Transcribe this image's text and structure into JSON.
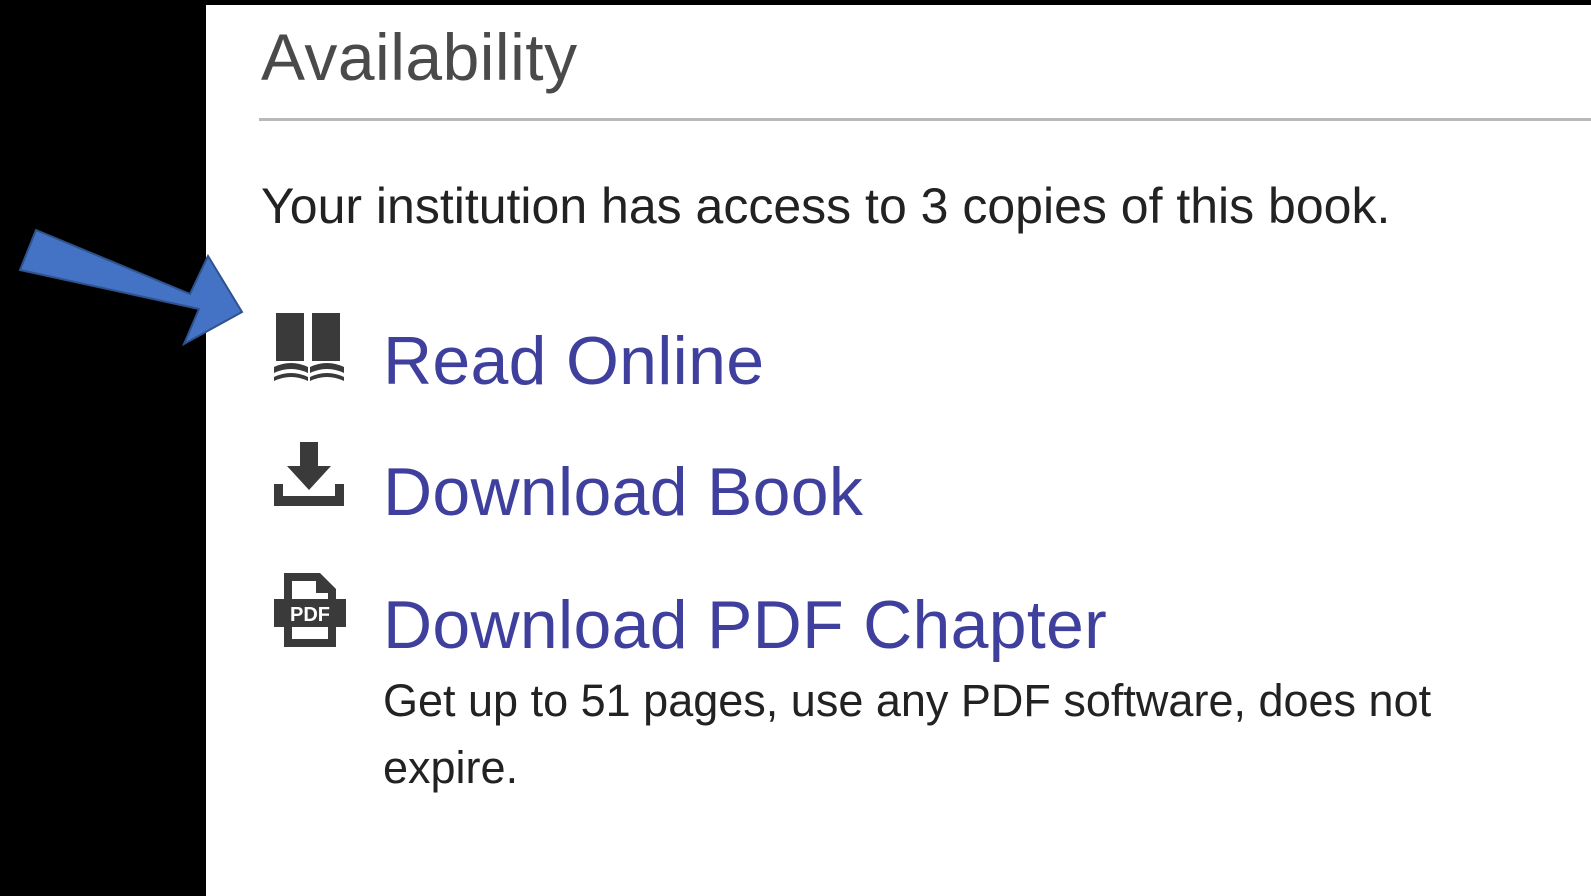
{
  "availability": {
    "title": "Availability",
    "access_text": "Your institution has access to 3 copies of this book."
  },
  "actions": [
    {
      "label": "Read Online",
      "icon": "book-icon"
    },
    {
      "label": "Download Book",
      "icon": "download-icon"
    },
    {
      "label": "Download PDF Chapter",
      "icon": "pdf-icon"
    }
  ],
  "pdf_description": "Get up to 51 pages, use any PDF software, does not expire.",
  "pdf_icon_text": "PDF",
  "colors": {
    "link": "#3f3f9e",
    "icon": "#3a3a3a",
    "arrow_fill": "#4472c4",
    "arrow_stroke": "#2f528f",
    "background": "#000000",
    "panel": "#ffffff"
  }
}
